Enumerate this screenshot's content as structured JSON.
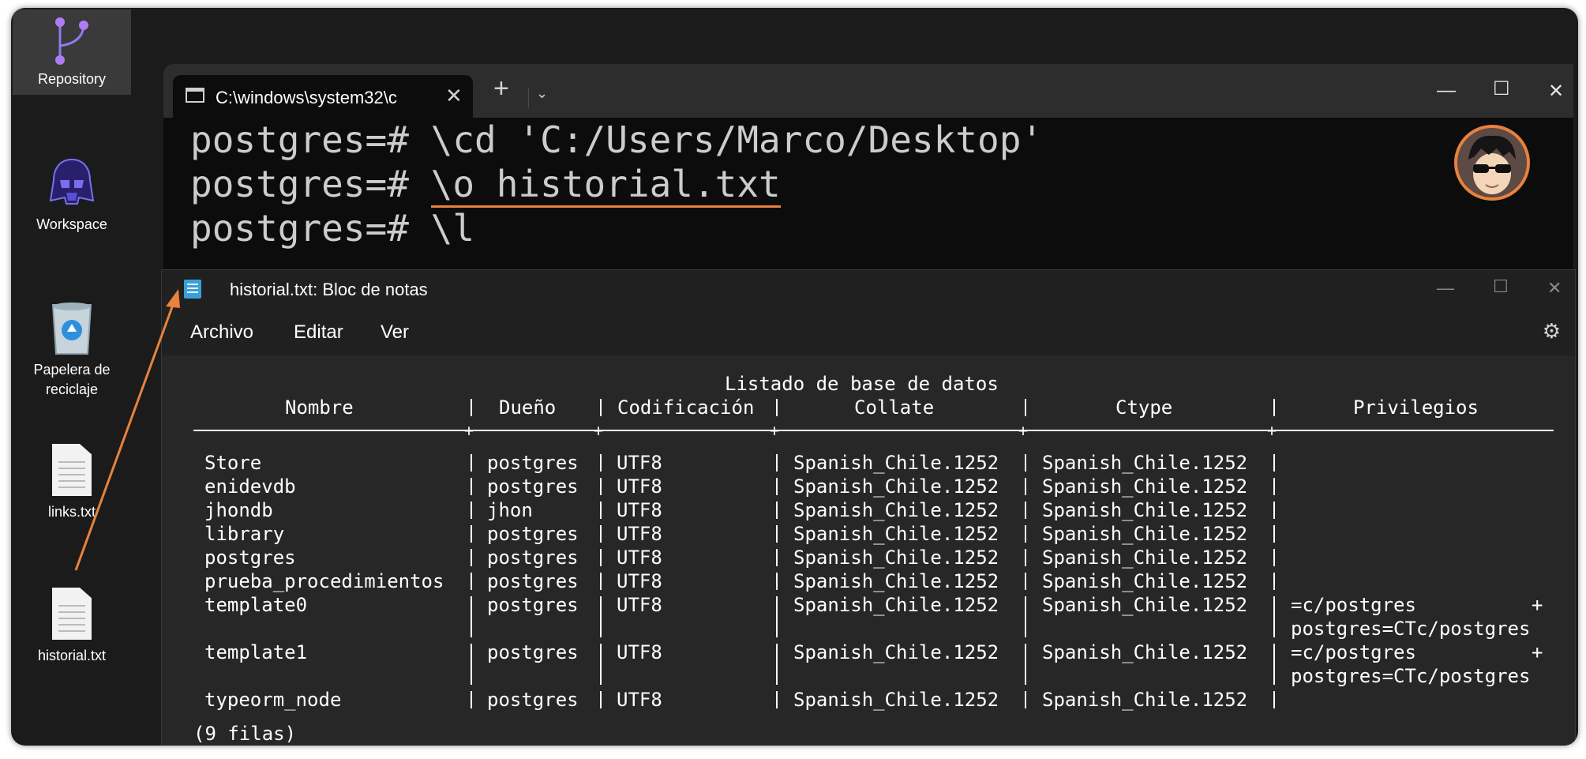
{
  "desktop": {
    "icons": [
      {
        "label": "Repository",
        "icon": "repository-icon"
      },
      {
        "label": "Workspace",
        "icon": "darth-vader-icon"
      },
      {
        "label": "Papelera de reciclaje",
        "icon": "recycle-bin-icon"
      },
      {
        "label": "links.txt",
        "icon": "text-file-icon"
      },
      {
        "label": "historial.txt",
        "icon": "text-file-icon"
      }
    ]
  },
  "terminal": {
    "tab_title": "C:\\windows\\system32\\c",
    "tab_close": "✕",
    "new_tab": "+",
    "dropdown": "⌄",
    "lines": [
      {
        "prompt": "postgres=# ",
        "command": "\\cd 'C:/Users/Marco/Desktop'"
      },
      {
        "prompt": "postgres=# ",
        "command": "\\o historial.txt"
      },
      {
        "prompt": "postgres=# ",
        "command": "\\l"
      }
    ],
    "window_buttons": {
      "minimize": "—",
      "maximize": "☐",
      "close": "✕"
    }
  },
  "notepad": {
    "title": "historial.txt: Bloc de notas",
    "menu": [
      "Archivo",
      "Editar",
      "Ver"
    ],
    "window_buttons": {
      "minimize": "—",
      "maximize": "☐",
      "close": "✕"
    },
    "settings_icon": "⚙",
    "table_title": "Listado de base de datos",
    "headers": [
      "Nombre",
      "Dueño",
      "Codificación",
      "Collate",
      "Ctype",
      "Privilegios"
    ],
    "rows": [
      {
        "name": "Store",
        "owner": "postgres",
        "encoding": "UTF8",
        "collate": "Spanish_Chile.1252",
        "ctype": "Spanish_Chile.1252",
        "privileges": "",
        "priv_plus": "",
        "extra": ""
      },
      {
        "name": "enidevdb",
        "owner": "postgres",
        "encoding": "UTF8",
        "collate": "Spanish_Chile.1252",
        "ctype": "Spanish_Chile.1252",
        "privileges": "",
        "priv_plus": "",
        "extra": ""
      },
      {
        "name": "jhondb",
        "owner": "jhon",
        "encoding": "UTF8",
        "collate": "Spanish_Chile.1252",
        "ctype": "Spanish_Chile.1252",
        "privileges": "",
        "priv_plus": "",
        "extra": ""
      },
      {
        "name": "library",
        "owner": "postgres",
        "encoding": "UTF8",
        "collate": "Spanish_Chile.1252",
        "ctype": "Spanish_Chile.1252",
        "privileges": "",
        "priv_plus": "",
        "extra": ""
      },
      {
        "name": "postgres",
        "owner": "postgres",
        "encoding": "UTF8",
        "collate": "Spanish_Chile.1252",
        "ctype": "Spanish_Chile.1252",
        "privileges": "",
        "priv_plus": "",
        "extra": ""
      },
      {
        "name": "prueba_procedimientos",
        "owner": "postgres",
        "encoding": "UTF8",
        "collate": "Spanish_Chile.1252",
        "ctype": "Spanish_Chile.1252",
        "privileges": "",
        "priv_plus": "",
        "extra": ""
      },
      {
        "name": "template0",
        "owner": "postgres",
        "encoding": "UTF8",
        "collate": "Spanish_Chile.1252",
        "ctype": "Spanish_Chile.1252",
        "privileges": "=c/postgres",
        "priv_plus": "+",
        "extra": "postgres=CTc/postgres"
      },
      {
        "name": "template1",
        "owner": "postgres",
        "encoding": "UTF8",
        "collate": "Spanish_Chile.1252",
        "ctype": "Spanish_Chile.1252",
        "privileges": "=c/postgres",
        "priv_plus": "+",
        "extra": "postgres=CTc/postgres"
      },
      {
        "name": "typeorm_node",
        "owner": "postgres",
        "encoding": "UTF8",
        "collate": "Spanish_Chile.1252",
        "ctype": "Spanish_Chile.1252",
        "privileges": "",
        "priv_plus": "",
        "extra": ""
      }
    ],
    "footer": "(9 filas)"
  },
  "colors": {
    "accent": "#e8823c",
    "terminal_bg": "#0c0c0c",
    "notepad_bg": "#272727"
  }
}
